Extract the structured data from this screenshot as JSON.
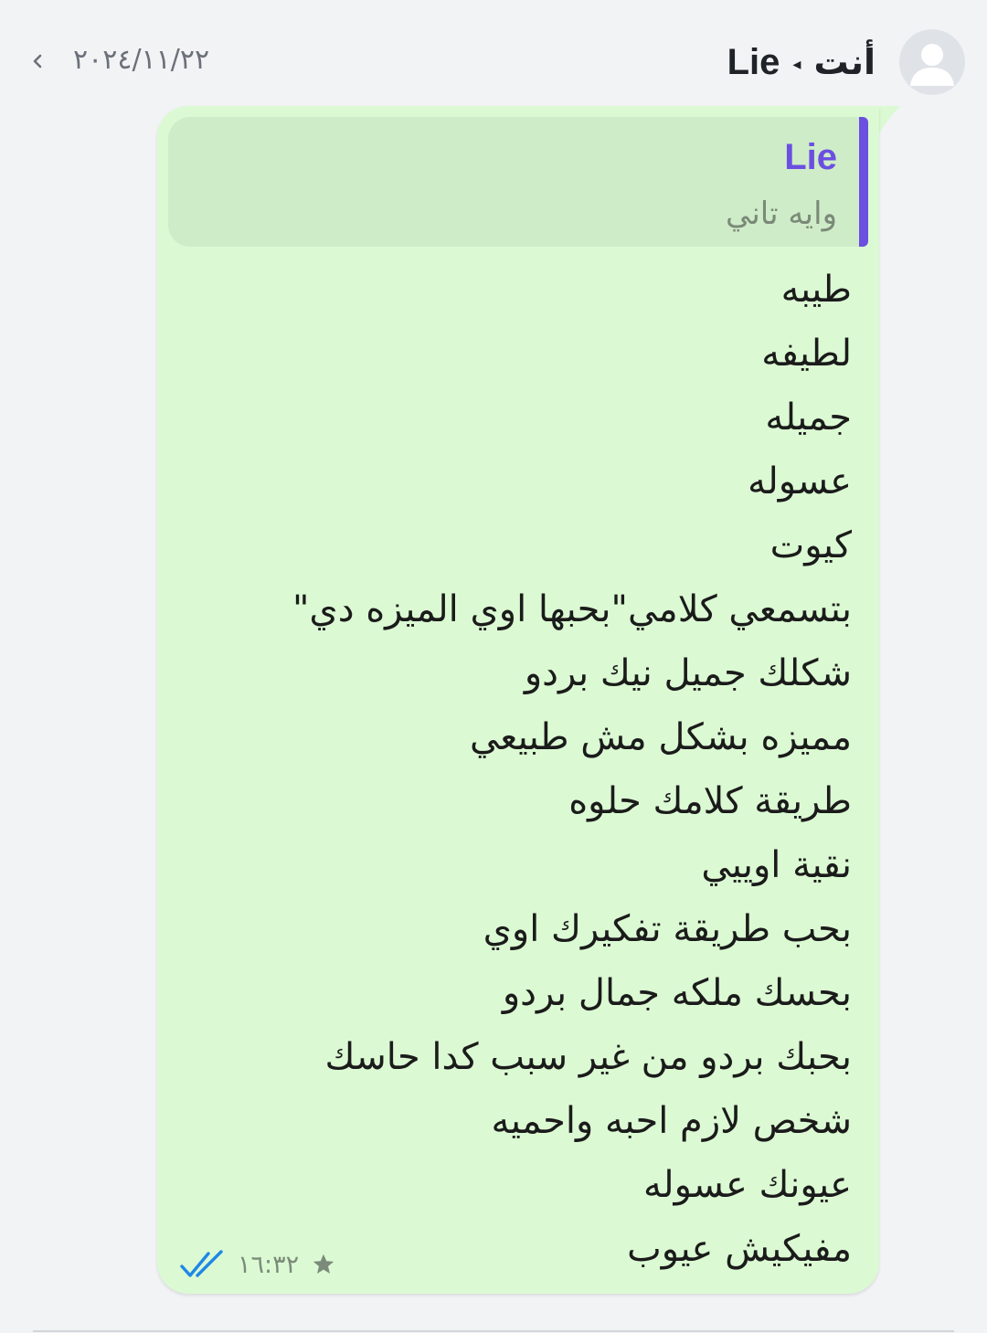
{
  "header": {
    "sender_label": "أنت",
    "recipient_name": "Lie",
    "date": "٢٠٢٤/١١/٢٢",
    "chevron_icon": "chevron-left-icon",
    "avatar_icon": "person-icon"
  },
  "message": {
    "reply": {
      "name": "Lie",
      "text": "وايه تاني"
    },
    "lines": [
      "طيبه",
      "لطيفه",
      "جميله",
      "عسوله",
      "كيوت",
      "بتسمعي كلامي\"بحبها اوي الميزه دي\"",
      "شكلك جميل نيك بردو",
      "مميزه بشكل مش طبيعي",
      "طريقة كلامك حلوه",
      "نقية اوييي",
      "بحب طريقة تفكيرك اوي",
      "بحسك ملكه جمال بردو",
      "بحبك بردو من غير سبب كدا حاسك",
      "شخص لازم احبه واحميه",
      "عيونك عسوله",
      "مفيكيش عيوب"
    ],
    "time": "١٦:٣٢",
    "status_icon": "double-check-icon",
    "starred_icon": "star-icon"
  },
  "colors": {
    "page_bg": "#f1f3f5",
    "bubble_bg": "#dbfad3",
    "reply_bg": "#cfecc8",
    "reply_accent": "#6b4fe0",
    "read_ticks": "#1e88e5"
  }
}
